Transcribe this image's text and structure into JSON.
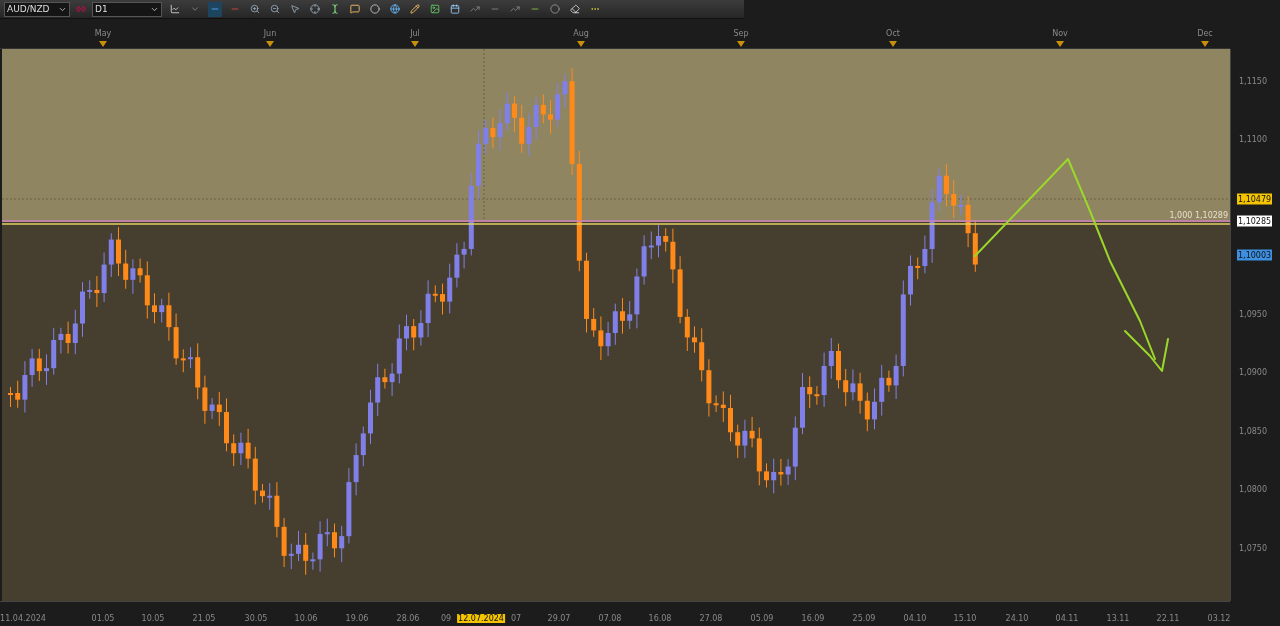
{
  "toolbar": {
    "symbol": "AUD/NZD",
    "timeframe": "D1"
  },
  "months": [
    "May",
    "Jun",
    "Jul",
    "Aug",
    "Sep",
    "Oct",
    "Nov",
    "Dec"
  ],
  "price_axis": [
    "1,1150",
    "1,1100",
    "1,0950",
    "1,0900",
    "1,0850",
    "1,0800",
    "1,0750"
  ],
  "price_tags": [
    {
      "label": "1,10479",
      "color": "#f5c400"
    },
    {
      "label": "1,10285",
      "color": "#ffffff"
    },
    {
      "label": "1,10003",
      "color": "#3d8fe0"
    }
  ],
  "fib_label": "1,000 1,10289",
  "time_axis": [
    {
      "label": "11.04.2024",
      "selected": false
    },
    {
      "label": "01.05",
      "selected": false
    },
    {
      "label": "10.05",
      "selected": false
    },
    {
      "label": "21.05",
      "selected": false
    },
    {
      "label": "30.05",
      "selected": false
    },
    {
      "label": "10.06",
      "selected": false
    },
    {
      "label": "19.06",
      "selected": false
    },
    {
      "label": "28.06",
      "selected": false
    },
    {
      "label": "09",
      "selected": false
    },
    {
      "label": "12.07.2024",
      "selected": true
    },
    {
      "label": "07",
      "selected": false
    },
    {
      "label": "29.07",
      "selected": false
    },
    {
      "label": "07.08",
      "selected": false
    },
    {
      "label": "16.08",
      "selected": false
    },
    {
      "label": "27.08",
      "selected": false
    },
    {
      "label": "05.09",
      "selected": false
    },
    {
      "label": "16.09",
      "selected": false
    },
    {
      "label": "25.09",
      "selected": false
    },
    {
      "label": "04.10",
      "selected": false
    },
    {
      "label": "15.10",
      "selected": false
    },
    {
      "label": "24.10",
      "selected": false
    },
    {
      "label": "04.11",
      "selected": false
    },
    {
      "label": "13.11",
      "selected": false
    },
    {
      "label": "22.11",
      "selected": false
    },
    {
      "label": "03.12",
      "selected": false
    }
  ]
}
